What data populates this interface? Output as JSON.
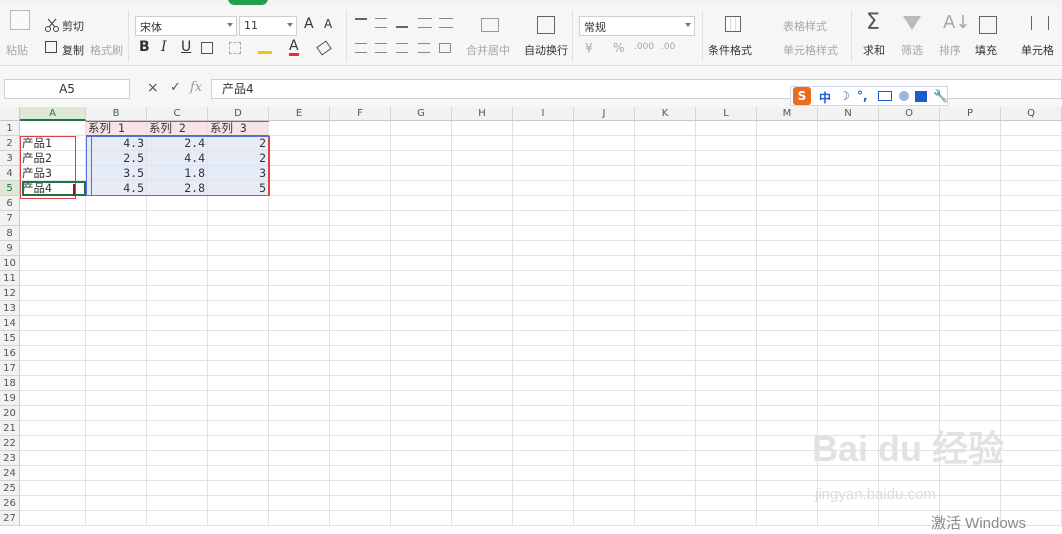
{
  "ribbon": {
    "font_name": "宋体",
    "font_size": "11",
    "number_format": "常规",
    "cut_label": "剪切",
    "copy_label": "复制",
    "paste_label": "粘贴",
    "format_painter_label": "格式刷",
    "merge_label": "合并居中",
    "wrap_label": "自动换行",
    "cond_format_label": "条件格式",
    "table_style_label": "表格样式",
    "cell_style_label": "单元格样式",
    "sum_label": "求和",
    "filter_label": "筛选",
    "sort_label": "排序",
    "fill_label": "填充",
    "cell_label": "单元格",
    "bold": "B",
    "italic": "I",
    "underline": "U",
    "currency": "¥",
    "percent": "%",
    "inc_decimal": ".000",
    "dec_decimal": ".00",
    "font_grow": "A",
    "font_shrink": "A"
  },
  "formula_bar": {
    "name_box": "A5",
    "formula": "产品4",
    "cancel": "×",
    "accept": "✓",
    "fx": "fx"
  },
  "columns": [
    "A",
    "B",
    "C",
    "D",
    "E",
    "F",
    "G",
    "H",
    "I",
    "J",
    "K",
    "L",
    "M",
    "N",
    "O",
    "P",
    "Q"
  ],
  "rows": [
    "1",
    "2",
    "3",
    "4",
    "5",
    "6",
    "7",
    "8",
    "9",
    "10",
    "11",
    "12",
    "13",
    "14",
    "15",
    "16",
    "17",
    "18",
    "19",
    "20",
    "21",
    "22",
    "23",
    "24",
    "25",
    "26",
    "27"
  ],
  "sheet": {
    "headers": [
      "系列 1",
      "系列 2",
      "系列 3"
    ],
    "data": [
      {
        "label": "产品1",
        "v": [
          "4.3",
          "2.4",
          "2"
        ]
      },
      {
        "label": "产品2",
        "v": [
          "2.5",
          "4.4",
          "2"
        ]
      },
      {
        "label": "产品3",
        "v": [
          "3.5",
          "1.8",
          "3"
        ]
      },
      {
        "label": "产品4",
        "v": [
          "4.5",
          "2.8",
          "5"
        ]
      }
    ]
  },
  "ime": {
    "logo": "S",
    "mode": "中",
    "moon": "☽",
    "punct": "°,"
  },
  "watermark": {
    "brand": "Bai du 经验",
    "url": "jingyan.baidu.com",
    "activation": "激活 Windows"
  },
  "colors": {
    "accent_green": "#217346",
    "selection_red": "#d9424a",
    "selection_blue": "#5570d6",
    "highlight_fill": "#e6ebf8"
  }
}
